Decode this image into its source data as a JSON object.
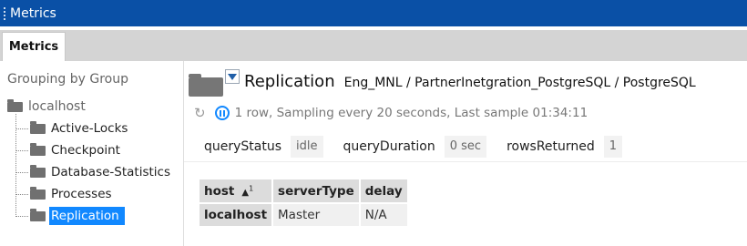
{
  "window": {
    "title": "Metrics"
  },
  "tabs": [
    {
      "label": "Metrics",
      "active": true
    }
  ],
  "sidebar": {
    "grouping_label": "Grouping by Group",
    "root": {
      "label": "localhost"
    },
    "items": [
      {
        "label": "Active-Locks",
        "selected": false
      },
      {
        "label": "Checkpoint",
        "selected": false
      },
      {
        "label": "Database-Statistics",
        "selected": false
      },
      {
        "label": "Processes",
        "selected": false
      },
      {
        "label": "Replication",
        "selected": true
      }
    ]
  },
  "main": {
    "title": "Replication",
    "path": "Eng_MNL / PartnerInetgration_PostgreSQL / PostgreSQL",
    "status": "1 row, Sampling every 20 seconds, Last sample 01:34:11",
    "fields": [
      {
        "label": "queryStatus",
        "value": "idle"
      },
      {
        "label": "queryDuration",
        "value": "0 sec"
      },
      {
        "label": "rowsReturned",
        "value": "1"
      }
    ],
    "table": {
      "columns": [
        "host",
        "serverType",
        "delay"
      ],
      "sort": {
        "column": "host",
        "direction": "ascending",
        "priority": "1"
      },
      "rows": [
        [
          "localhost",
          "Master",
          "N/A"
        ]
      ]
    }
  },
  "icons": {
    "grip": "grip-dots-icon",
    "folder": "folder-icon",
    "filter": "funnel-icon",
    "refresh": "refresh-icon",
    "pause": "pause-circle-icon"
  },
  "colors": {
    "titlebar": "#0a50a6",
    "selection": "#1188ff",
    "pause": "#1188ff",
    "filter": "#1f5ea8"
  }
}
